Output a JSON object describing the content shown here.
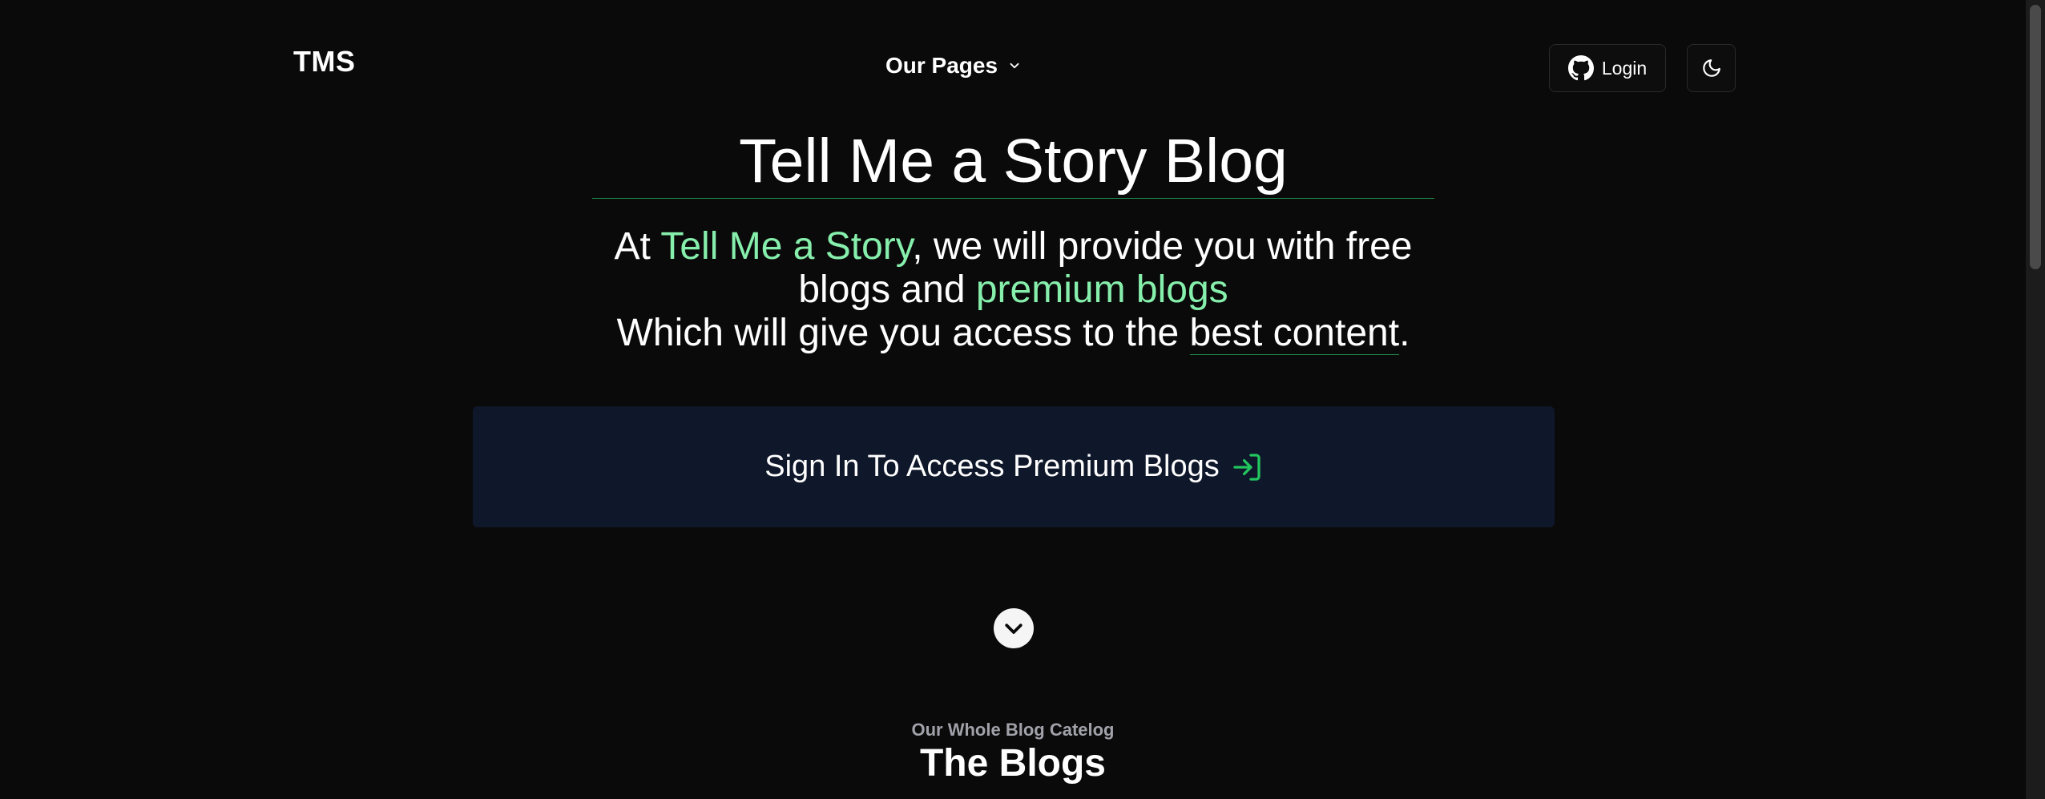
{
  "header": {
    "logo": "TMS",
    "nav_pages_label": "Our Pages",
    "login_label": "Login"
  },
  "hero": {
    "title": "Tell Me a Story Blog",
    "line1_prefix": "At ",
    "line1_highlight": "Tell Me a Story",
    "line1_suffix": ", we will provide you with free",
    "line2_prefix": "blogs and ",
    "line2_highlight": "premium blogs",
    "line3_prefix": "Which will give you access to the ",
    "line3_underlined": "best content",
    "line3_suffix": "."
  },
  "cta": {
    "label": "Sign In To Access Premium Blogs"
  },
  "section": {
    "subtitle": "Our Whole Blog Catelog",
    "title": "The Blogs"
  },
  "colors": {
    "background": "#0a0a0a",
    "accent_green": "#86efac",
    "rule_green": "#1f8a4a",
    "cta_background": "#0f172a"
  },
  "icons": {
    "nav_dropdown": "chevron-down-icon",
    "login": "github-icon",
    "theme": "moon-icon",
    "cta": "sign-in-icon",
    "scroll": "chevron-down-circle-icon"
  }
}
